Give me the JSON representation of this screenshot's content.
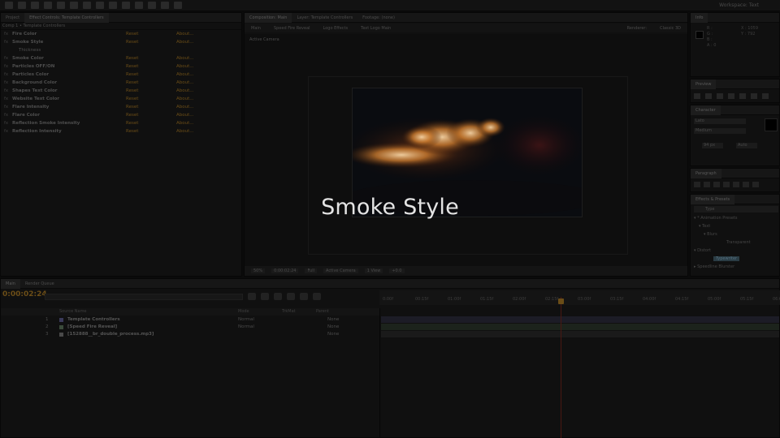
{
  "toolbar": {
    "workspace_label": "Workspace:",
    "workspace_value": "Text"
  },
  "effect_controls": {
    "tab_project": "Project",
    "tab_label": "Effect Controls: Template Controllers",
    "subheader": "Comp 1 • Template Controllers",
    "rows": [
      {
        "name": "Fire Color",
        "reset": "Reset",
        "about": "About..."
      },
      {
        "name": "Smoke Style",
        "reset": "Reset",
        "about": "About..."
      },
      {
        "name": "Thickness",
        "reset": "",
        "about": "",
        "sub": true
      },
      {
        "name": "Smoke Color",
        "reset": "Reset",
        "about": "About..."
      },
      {
        "name": "Particles OFF/ON",
        "reset": "Reset",
        "about": "About..."
      },
      {
        "name": "Particles Color",
        "reset": "Reset",
        "about": "About..."
      },
      {
        "name": "Background Color",
        "reset": "Reset",
        "about": "About..."
      },
      {
        "name": "Shapes Text Color",
        "reset": "Reset",
        "about": "About..."
      },
      {
        "name": "Website Text Color",
        "reset": "Reset",
        "about": "About..."
      },
      {
        "name": "Flare Intensity",
        "reset": "Reset",
        "about": "About..."
      },
      {
        "name": "Flare Color",
        "reset": "Reset",
        "about": "About..."
      },
      {
        "name": "Reflection Smoke Intensity",
        "reset": "Reset",
        "about": "About..."
      },
      {
        "name": "Reflection Intensity",
        "reset": "Reset",
        "about": "About..."
      }
    ]
  },
  "composition": {
    "tab_label": "Composition: Main",
    "tab_2": "Layer: Template Controllers",
    "tab_3": "Footage: (none)",
    "subtabs": [
      "Main",
      "Speed Fire Reveal",
      "Logo Effects",
      "Text Logo Main"
    ],
    "renderer_label": "Renderer:",
    "renderer_value": "Classic 3D",
    "camera_label": "Active Camera",
    "controls": [
      "50%",
      "0:00:02:24",
      "Full",
      "Active Camera",
      "1 View",
      "+0.0"
    ]
  },
  "info": {
    "tab_label": "Info",
    "r": "R :",
    "g": "G :",
    "b": "B :",
    "a": "A : 0",
    "x": "X : 1059",
    "y": "Y : 792"
  },
  "preview": {
    "tab_label": "Preview"
  },
  "character": {
    "tab_label": "Character",
    "font": "Lato",
    "style": "Medium",
    "size": "94 px",
    "leading": "Auto"
  },
  "paragraph": {
    "tab_label": "Paragraph"
  },
  "presets": {
    "tab_label": "Effects & Presets",
    "search": "Type",
    "tree": [
      "▾ * Animation Presets",
      "▾ Text",
      "▾ Blurs",
      "Transparent",
      "▾ Distort",
      "Typewriter",
      "▸ Keying",
      "▸ Speedline Blurster"
    ]
  },
  "timeline": {
    "tab_main": "Main",
    "tab_2": "Render Queue",
    "timecode": "0:00:02:24",
    "col_source": "Source Name",
    "col_mode": "Mode",
    "col_trkmat": "TrkMat",
    "col_parent": "Parent",
    "layers": [
      {
        "num": "1",
        "name": "Template Controllers",
        "mode": "Normal",
        "parent": "None",
        "color": "#3a3a5a"
      },
      {
        "num": "2",
        "name": "[Speed Fire Reveal]",
        "mode": "Normal",
        "parent": "None",
        "color": "#3a4a3a"
      },
      {
        "num": "3",
        "name": "[152888__br_double_process.mp3]",
        "mode": "",
        "parent": "None",
        "color": "#4a4a4a"
      }
    ],
    "ticks": [
      "0:00f",
      "00:15f",
      "01:00f",
      "01:15f",
      "02:00f",
      "02:15f",
      "03:00f",
      "03:15f",
      "04:00f",
      "04:15f",
      "05:00f",
      "05:15f",
      "06:00f"
    ]
  },
  "overlay": {
    "title": "Smoke Style"
  },
  "colors": {
    "accent_orange": "#6b4d17",
    "playhead": "#4a1812",
    "selection": "#2a3c44"
  }
}
